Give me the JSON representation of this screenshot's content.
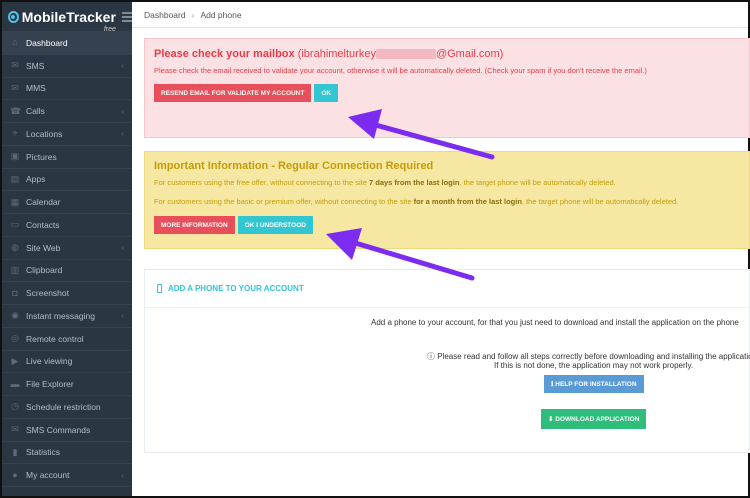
{
  "app": {
    "logo_text": "MobileTracker",
    "logo_sub": "free"
  },
  "sidebar": {
    "items": [
      {
        "label": "Dashboard",
        "icon": "home-icon",
        "chevron": false,
        "active": true
      },
      {
        "label": "SMS",
        "icon": "envelope-icon",
        "chevron": true
      },
      {
        "label": "MMS",
        "icon": "envelope-icon",
        "chevron": false
      },
      {
        "label": "Calls",
        "icon": "phone-icon",
        "chevron": true
      },
      {
        "label": "Locations",
        "icon": "map-icon",
        "chevron": true
      },
      {
        "label": "Pictures",
        "icon": "picture-icon",
        "chevron": false
      },
      {
        "label": "Apps",
        "icon": "apps-icon",
        "chevron": false
      },
      {
        "label": "Calendar",
        "icon": "calendar-icon",
        "chevron": false
      },
      {
        "label": "Contacts",
        "icon": "contacts-icon",
        "chevron": false
      },
      {
        "label": "Site Web",
        "icon": "globe-icon",
        "chevron": true
      },
      {
        "label": "Clipboard",
        "icon": "clipboard-icon",
        "chevron": false
      },
      {
        "label": "Screenshot",
        "icon": "camera-icon",
        "chevron": false
      },
      {
        "label": "Instant messaging",
        "icon": "chat-icon",
        "chevron": true
      },
      {
        "label": "Remote control",
        "icon": "remote-icon",
        "chevron": false
      },
      {
        "label": "Live viewing",
        "icon": "video-icon",
        "chevron": false
      },
      {
        "label": "File Explorer",
        "icon": "folder-icon",
        "chevron": false
      },
      {
        "label": "Schedule restriction",
        "icon": "clock-icon",
        "chevron": false
      },
      {
        "label": "SMS Commands",
        "icon": "envelope-icon",
        "chevron": false
      },
      {
        "label": "Statistics",
        "icon": "chart-icon",
        "chevron": false
      },
      {
        "label": "My account",
        "icon": "user-icon",
        "chevron": true
      }
    ]
  },
  "breadcrumb": {
    "home": "Dashboard",
    "current": "Add phone"
  },
  "mailbox_alert": {
    "title": "Please check your mailbox",
    "email_prefix": "(ibrahimelturkey",
    "email_suffix": "@Gmail.com)",
    "message": "Please check the email received to validate your account, otherwise it will be automatically deleted. (Check your spam if you don't receive the email.)",
    "resend_label": "RESEND EMAIL FOR VALIDATE MY ACCOUNT",
    "ok_label": "OK"
  },
  "info_alert": {
    "title": "Important Information - Regular Connection Required",
    "free_pre": "For customers using the free offer, without connecting to the site ",
    "free_bold": "7 days from the last login",
    "free_post": ", the target phone will be automatically deleted.",
    "premium_pre": "For customers using the basic or premium offer, without connecting to the site ",
    "premium_bold": "for a month from the last login",
    "premium_post": ", the target phone will be automatically deleted.",
    "more_label": "MORE INFORMATION",
    "understood_label": "OK I UNDERSTOOD"
  },
  "add_phone": {
    "title": "ADD A PHONE TO YOUR ACCOUNT",
    "intro": "Add a phone to your account, for that you just need to download and install the application on the phone",
    "warning_line1": "Please read and follow all steps correctly before downloading and installing the application",
    "warning_line2": "If this is not done, the application may not work properly.",
    "help_label": "HELP FOR INSTALLATION",
    "download_label": "DOWNLOAD APPLICATION"
  },
  "colors": {
    "arrow": "#7b2cf0",
    "sidebar_bg": "#2b3643",
    "danger": "#e7505a",
    "info": "#32c5d2",
    "warning_bg": "#f6e8a3",
    "success": "#2ebd7a"
  }
}
